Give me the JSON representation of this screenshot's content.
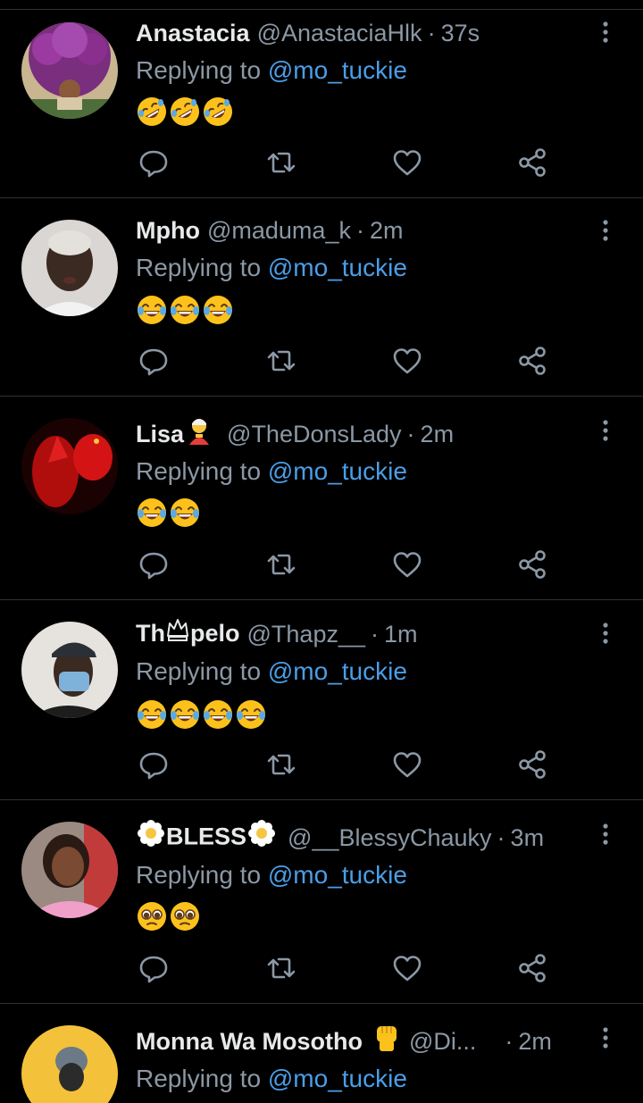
{
  "colors": {
    "background": "#000000",
    "divider": "#2f3336",
    "name": "#e7e9ea",
    "secondary": "#8b98a5",
    "link": "#4a9ee8"
  },
  "icons": {
    "reply": "reply-icon",
    "retweet": "retweet-icon",
    "like": "heart-icon",
    "share": "share-icon",
    "more": "more-vertical-icon"
  },
  "replying_prefix": "Replying to ",
  "tweets": [
    {
      "name": "Anastacia",
      "handle": "@AnastaciaHlk",
      "separator": "·",
      "time": "37s",
      "mention": "@mo_tuckie",
      "emojis": [
        "rolling-on-floor-laughing",
        "rolling-on-floor-laughing",
        "rolling-on-floor-laughing"
      ]
    },
    {
      "name": "Mpho",
      "handle": "@maduma_k",
      "separator": "·",
      "time": "2m",
      "mention": "@mo_tuckie",
      "emojis": [
        "face-with-tears-of-joy",
        "face-with-tears-of-joy",
        "face-with-tears-of-joy"
      ]
    },
    {
      "name": "Lisa",
      "name_emoji": "genie",
      "handle": "@TheDonsLady",
      "separator": "·",
      "time": "2m",
      "mention": "@mo_tuckie",
      "emojis": [
        "face-with-tears-of-joy",
        "face-with-tears-of-joy"
      ]
    },
    {
      "name_part1": "Th",
      "name_emoji": "crown",
      "name_part2": "pelo",
      "handle": "@Thapz__",
      "separator": "·",
      "time": "1m",
      "mention": "@mo_tuckie",
      "emojis": [
        "face-with-tears-of-joy",
        "face-with-tears-of-joy",
        "face-with-tears-of-joy",
        "face-with-tears-of-joy"
      ]
    },
    {
      "name": "BLESS",
      "name_emoji": "blossom",
      "handle": "@__BlessyChauky",
      "separator": "·",
      "time": "3m",
      "mention": "@mo_tuckie",
      "emojis": [
        "pleading-face",
        "pleading-face"
      ]
    },
    {
      "name": "Monna Wa Mosotho",
      "name_emoji": "raised-fist",
      "handle": "@Di...",
      "separator": "·",
      "time": "2m",
      "mention": "@mo_tuckie",
      "emojis": []
    }
  ]
}
